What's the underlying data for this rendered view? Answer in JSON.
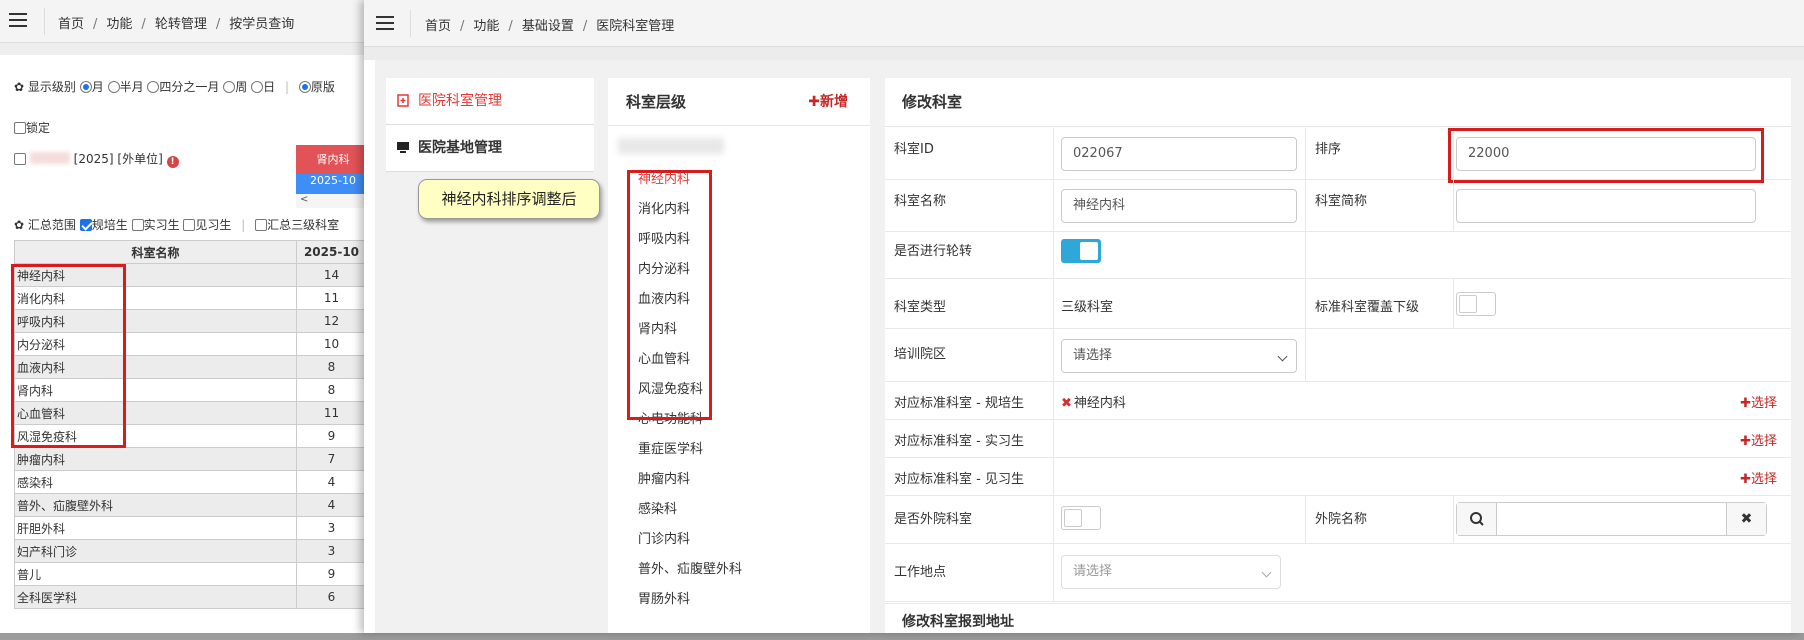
{
  "back_window": {
    "breadcrumb": [
      "首页",
      "功能",
      "轮转管理",
      "按学员查询"
    ],
    "display_level": {
      "label": "显示级别",
      "options": [
        "月",
        "半月",
        "四分之一月",
        "周",
        "日"
      ],
      "selected": "月",
      "extra_option": "原版"
    },
    "lock_label": "锁定",
    "month_button": "2025-10",
    "dept_button": "肾内科",
    "student_suffix": "[2025]",
    "student_unit": "[外单位]",
    "summary": {
      "label": "汇总范围",
      "options": [
        {
          "label": "规培生",
          "checked": true
        },
        {
          "label": "实习生",
          "checked": false
        },
        {
          "label": "见习生",
          "checked": false
        }
      ],
      "extra": "汇总三级科室"
    },
    "scroll_arrow": "<",
    "table": {
      "headers": [
        "科室名称",
        "2025-10"
      ],
      "rows": [
        [
          "神经内科",
          "14"
        ],
        [
          "消化内科",
          "11"
        ],
        [
          "呼吸内科",
          "12"
        ],
        [
          "内分泌科",
          "10"
        ],
        [
          "血液内科",
          "8"
        ],
        [
          "肾内科",
          "8"
        ],
        [
          "心血管科",
          "11"
        ],
        [
          "风湿免疫科",
          "9"
        ],
        [
          "肿瘤内科",
          "7"
        ],
        [
          "感染科",
          "4"
        ],
        [
          "普外、疝腹壁外科",
          "4"
        ],
        [
          "肝胆外科",
          "3"
        ],
        [
          "妇产科门诊",
          "3"
        ],
        [
          "普儿",
          "9"
        ],
        [
          "全科医学科",
          "6"
        ]
      ]
    },
    "callout": "神经内科排序调整后"
  },
  "front_window": {
    "breadcrumb": [
      "首页",
      "功能",
      "基础设置",
      "医院科室管理"
    ],
    "left_nav": [
      {
        "label": "医院科室管理",
        "icon": "hospital-icon",
        "active": true
      },
      {
        "label": "医院基地管理",
        "icon": "monitor-icon",
        "active": false
      }
    ],
    "tree": {
      "title": "科室层级",
      "add_label": "新增",
      "nodes": [
        "神经内科",
        "消化内科",
        "呼吸内科",
        "内分泌科",
        "血液内科",
        "肾内科",
        "心血管科",
        "风湿免疫科",
        "心电功能科",
        "重症医学科",
        "肿瘤内科",
        "感染科",
        "门诊内科",
        "普外、疝腹壁外科",
        "胃肠外科"
      ],
      "selected": "神经内科"
    },
    "form": {
      "title": "修改科室",
      "dept_id_label": "科室ID",
      "dept_id": "022067",
      "order_label": "排序",
      "order": "22000",
      "dept_name_label": "科室名称",
      "dept_name": "神经内科",
      "short_name_label": "科室简称",
      "short_name": "",
      "rotation_label": "是否进行轮转",
      "rotation_on": true,
      "dept_type_label": "科室类型",
      "dept_type": "三级科室",
      "std_cover_label": "标准科室覆盖下级",
      "std_cover_on": false,
      "campus_label": "培训院区",
      "campus_placeholder": "请选择",
      "std_resident_label": "对应标准科室 - 规培生",
      "std_resident_value": "神经内科",
      "std_intern_label": "对应标准科室 - 实习生",
      "std_trainee_label": "对应标准科室 - 见习生",
      "choose_label": "选择",
      "external_label": "是否外院科室",
      "external_on": false,
      "external_name_label": "外院名称",
      "workplace_label": "工作地点",
      "workplace_placeholder": "请选择",
      "footer_title": "修改科室报到地址"
    }
  },
  "colors": {
    "accent_red": "#e53935",
    "toggle_blue": "#2ea8d9",
    "highlight_box": "#d61c1c",
    "btn_blue": "#3f8ef7",
    "btn_red": "#e15357"
  }
}
